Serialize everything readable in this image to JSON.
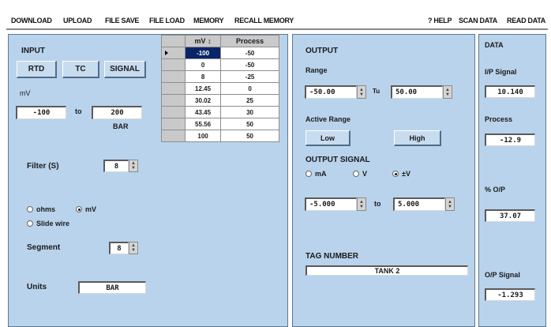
{
  "menu": {
    "download": "DOWNLOAD",
    "upload": "UPLOAD",
    "file_save": "FILE SAVE",
    "file_load": "FILE LOAD",
    "memory": "MEMORY",
    "recall_memory": "RECALL MEMORY",
    "help": "? HELP",
    "scan_data": "SCAN DATA",
    "read_data": "READ DATA"
  },
  "input": {
    "title": "INPUT",
    "buttons": {
      "rtd": "RTD",
      "tc": "TC",
      "signal": "SIGNAL"
    },
    "unit_label": "mV",
    "range_low": "-100",
    "to_label": "to",
    "range_high": "200",
    "range_unit": "BAR",
    "filter_label": "Filter (S)",
    "filter_value": "8",
    "radio_ohms": "ohms",
    "radio_mv": "mV",
    "radio_slide": "Slide wire",
    "selected_mode": "mV",
    "segment_label": "Segment",
    "segment_value": "8",
    "units_label": "Units",
    "units_value": "BAR"
  },
  "table": {
    "headers": [
      "mV",
      "Process"
    ],
    "rows": [
      [
        "-100",
        "-50"
      ],
      [
        "0",
        "-50"
      ],
      [
        "8",
        "-25"
      ],
      [
        "12.45",
        "0"
      ],
      [
        "30.02",
        "25"
      ],
      [
        "43.45",
        "30"
      ],
      [
        "55.56",
        "50"
      ],
      [
        "100",
        "50"
      ]
    ]
  },
  "output": {
    "title": "OUTPUT",
    "range_label": "Range",
    "range_low": "-50.00",
    "to_label": "Tu",
    "range_high": "50.00",
    "active_range_label": "Active Range",
    "low_button": "Low",
    "high_button": "High",
    "signal_label": "OUTPUT SIGNAL",
    "radio_ma": "mA",
    "radio_v": "V",
    "radio_pmv": "±V",
    "selected_signal": "±V",
    "sig_low": "-5.000",
    "sig_to": "to",
    "sig_high": "5.000",
    "tag_label": "TAG NUMBER",
    "tag_value": "TANK 2"
  },
  "data": {
    "title": "DATA",
    "ip_label": "I/P Signal",
    "ip_value": "10.140",
    "process_label": "Process",
    "process_value": "-12.9",
    "pct_label": "% O/P",
    "pct_value": "37.07",
    "op_label": "O/P Signal",
    "op_value": "-1.293"
  }
}
